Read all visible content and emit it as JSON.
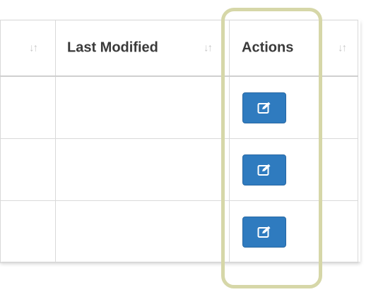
{
  "table": {
    "columns": [
      {
        "label": "",
        "sort_icon": "sort-icon"
      },
      {
        "label": "Last Modified",
        "sort_icon": "sort-icon"
      },
      {
        "label": "Actions",
        "sort_icon": "sort-icon"
      }
    ],
    "rows": [
      {
        "cells": [
          "",
          ""
        ],
        "action": "edit-icon"
      },
      {
        "cells": [
          "",
          ""
        ],
        "action": "edit-icon"
      },
      {
        "cells": [
          "",
          ""
        ],
        "action": "edit-icon"
      }
    ]
  },
  "colors": {
    "button_bg": "#2f7bbf",
    "highlight_border": "#d6d7a8",
    "sort_icon": "#c8c8c8",
    "border": "#d9d9d9"
  }
}
